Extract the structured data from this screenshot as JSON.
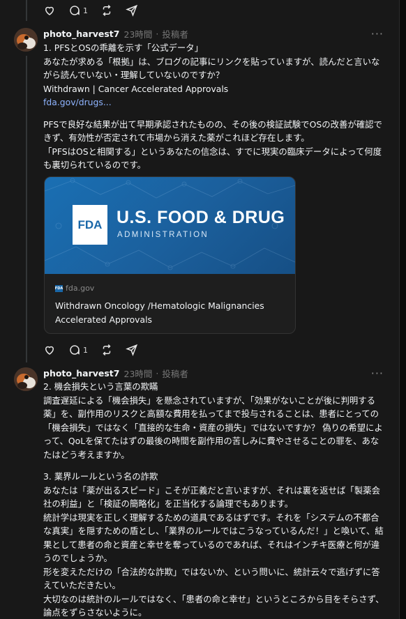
{
  "top_actions": {
    "reply_count": "1"
  },
  "posts": [
    {
      "username": "photo_harvest7",
      "time": "23時間",
      "separator": "·",
      "role": "投稿者",
      "more": "···",
      "lines1": [
        "1. PFSとOSの乖離を示す「公式データ」",
        "あなたが求める「根拠」は、ブログの記事にリンクを貼っていますが、読んだと言いながら読んでいない・理解していないのですか？",
        "Withdrawn | Cancer Accelerated Approvals"
      ],
      "link": "fda.gov/drugs...",
      "para2": "PFSで良好な結果が出て早期承認されたものの、その後の検証試験でOSの改善が確認できず、有効性が否定されて市場から消えた薬がこれほど存在します。",
      "para3": "「PFSはOSと相関する」というあなたの信念は、すでに現実の臨床データによって何度も裏切られているのです。",
      "card": {
        "logo": "FDA",
        "title_line": "U.S. FOOD & DRUG",
        "sub_line": "ADMINISTRATION",
        "domain": "fda.gov",
        "title": "Withdrawn Oncology /Hematologic Malignancies Accelerated Approvals"
      },
      "reply_count": "1"
    },
    {
      "username": "photo_harvest7",
      "time": "23時間",
      "separator": "·",
      "role": "投稿者",
      "more": "···",
      "section2_title": "2. 機会損失という言葉の欺瞞",
      "section2_body": "調査遅延による「機会損失」を懸念されていますが、「効果がないことが後に判明する薬」を、副作用のリスクと高額な費用を払ってまで投与されることは、患者にとっての「機会損失」ではなく「直接的な生命・資産の損失」ではないですか？ 偽りの希望によって、QoLを保てたはずの最後の時間を副作用の苦しみに費やさせることの罪を、あなたはどう考えますか。",
      "section3_title": "3. 業界ルールという名の詐欺",
      "section3_p1": "あなたは「薬が出るスピード」こそが正義だと言いますが、それは裏を返せば「製薬会社の利益」と「検証の簡略化」を正当化する論理でもあります。",
      "section3_p2": "統計学は現実を正しく理解するための道具であるはずです。それを「システムの不都合な真実」を隠すための盾とし、「業界のルールではこうなっているんだ！」と喚いて、結果として患者の命と資産と幸せを奪っているのであれば、それはインチキ医療と何が違うのでしょうか。",
      "section3_p3": "形を変えただけの「合法的な詐欺」ではないか、という問いに、統計云々で逃げずに答えていただきたい。",
      "section3_p4": "大切なのは統計のルールではなく、「患者の命と幸せ」というところから目をそらさず、論点をずらさないように。"
    }
  ],
  "icons": [
    "heart-icon",
    "comment-icon",
    "repost-icon",
    "share-icon",
    "more-icon"
  ],
  "colors": {
    "background": "#181818",
    "text": "#f3f5f7",
    "link": "#8fb4ff",
    "meta": "#777777",
    "fda_blue": "#1a67a8"
  }
}
